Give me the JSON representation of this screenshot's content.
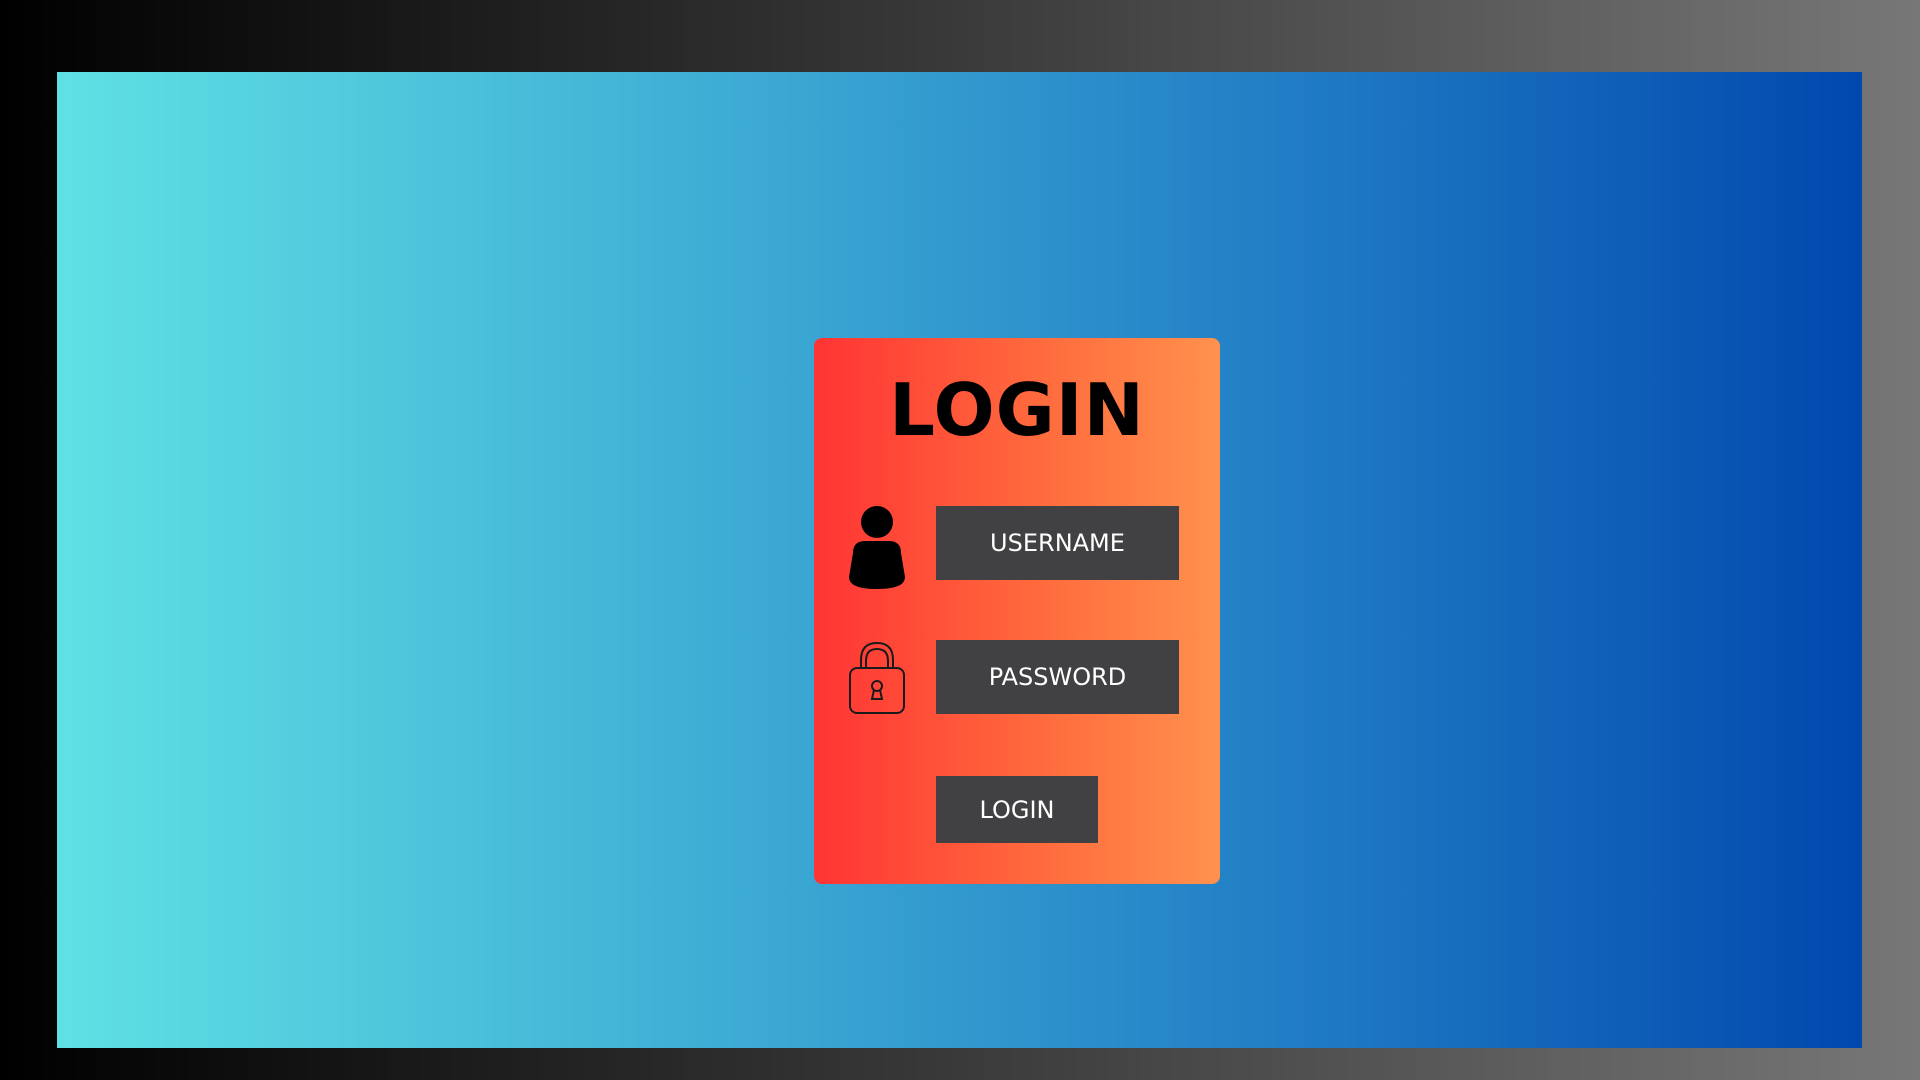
{
  "login_card": {
    "title": "LOGIN",
    "username_field": {
      "label": "USERNAME",
      "icon": "user-icon"
    },
    "password_field": {
      "label": "PASSWORD",
      "icon": "lock-icon"
    },
    "submit_label": "LOGIN"
  },
  "colors": {
    "outer_gradient": [
      "#000000",
      "#777777"
    ],
    "frame_gradient": [
      "#5fe1e4",
      "#0148ad"
    ],
    "card_gradient": [
      "#ff3434",
      "#ff914d"
    ],
    "field_background": "#414143",
    "field_text": "#ffffff"
  }
}
